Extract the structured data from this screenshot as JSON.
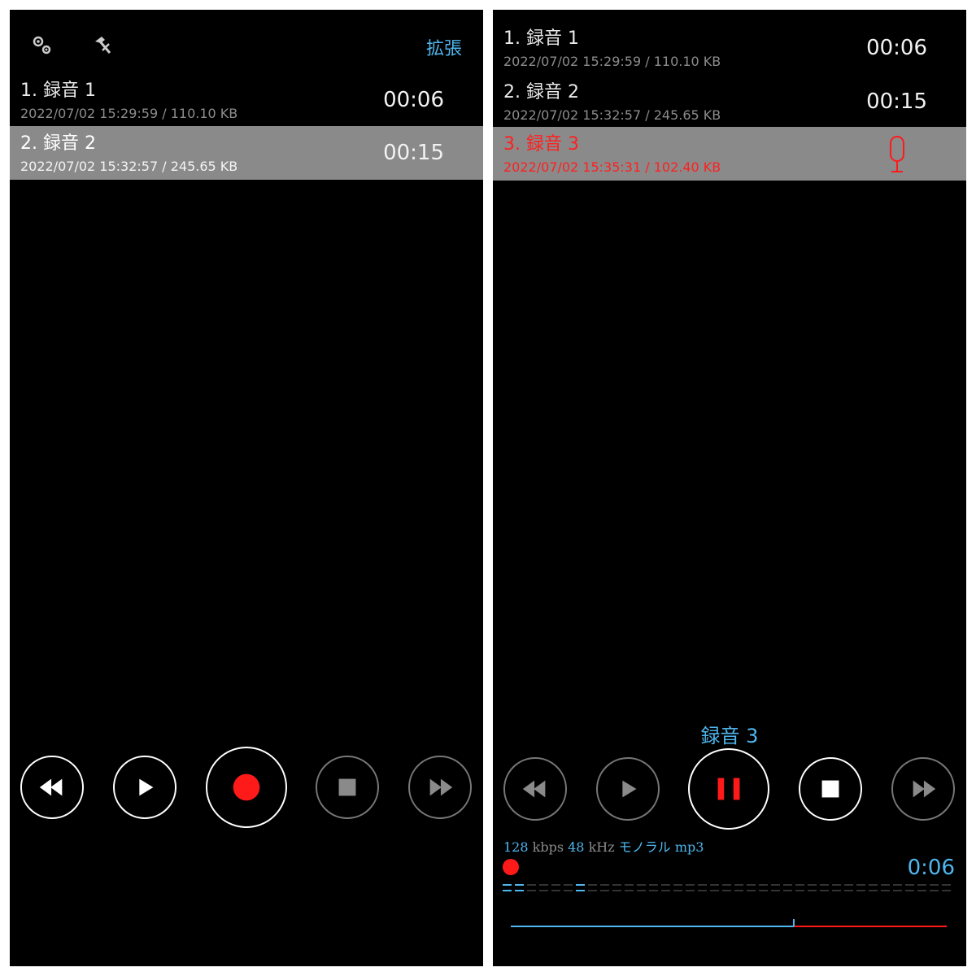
{
  "left_screen": {
    "toolbar": {
      "settings_icon": "gears-icon",
      "tools_icon": "hammer-icon",
      "expand_label": "拡張"
    },
    "recordings": [
      {
        "title": "1. 録音 1",
        "meta": "2022/07/02 15:29:59 / 110.10 KB",
        "duration": "00:06",
        "selected": false
      },
      {
        "title": "2. 録音 2",
        "meta": "2022/07/02 15:32:57 / 245.65 KB",
        "duration": "00:15",
        "selected": true
      }
    ],
    "controls": [
      "rewind-icon",
      "play-icon",
      "record-icon",
      "stop-icon",
      "fast-forward-icon"
    ]
  },
  "right_screen": {
    "recordings": [
      {
        "title": "1. 録音 1",
        "meta": "2022/07/02 15:29:59 / 110.10 KB",
        "duration": "00:06"
      },
      {
        "title": "2. 録音 2",
        "meta": "2022/07/02 15:32:57 / 245.65 KB",
        "duration": "00:15"
      },
      {
        "title": "3. 録音 3",
        "meta": "2022/07/02 15:35:31 / 102.40 KB",
        "status_icon": "microphone-icon",
        "recording": true
      }
    ],
    "current_recording_title": "録音 3",
    "controls": [
      "rewind-icon",
      "play-icon",
      "pause-icon",
      "stop-icon",
      "fast-forward-icon"
    ],
    "format": {
      "bitrate": "128",
      "bitrate_unit": "kbps",
      "sample_rate": "48",
      "sample_rate_unit": "kHz",
      "channels": "モノラル",
      "codec": "mp3"
    },
    "elapsed": "0:06",
    "timeline_progress": 0.65
  },
  "colors": {
    "accent": "#4fb6ee",
    "record": "#ff1a1a",
    "selected_row": "#8a8a8a"
  }
}
